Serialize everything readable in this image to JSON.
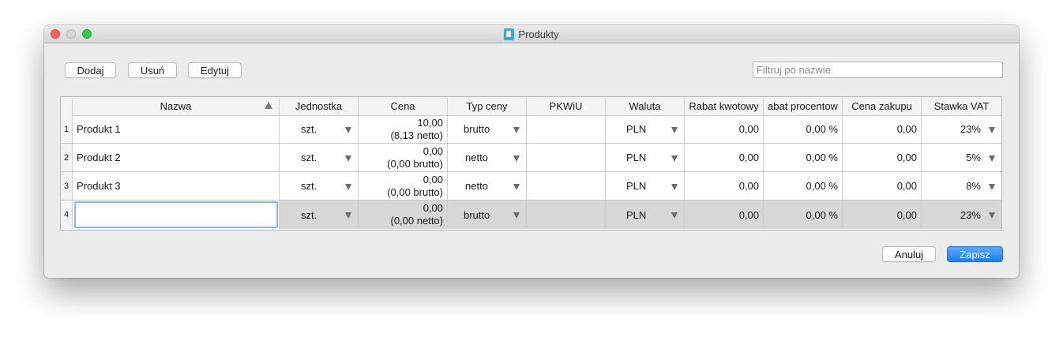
{
  "window": {
    "title": "Produkty"
  },
  "toolbar": {
    "add_label": "Dodaj",
    "remove_label": "Usuń",
    "edit_label": "Edytuj"
  },
  "filter": {
    "placeholder": "Filtruj po nazwie",
    "value": ""
  },
  "table": {
    "columns": [
      "Nazwa",
      "Jednostka",
      "Cena",
      "Typ ceny",
      "PKWiU",
      "Waluta",
      "Rabat kwotowy",
      "abat procentow",
      "Cena zakupu",
      "Stawka VAT"
    ],
    "rows": [
      {
        "index": "1",
        "name": "Produkt 1",
        "unit": "szt.",
        "price": "10,00",
        "price_alt": "(8,13 netto)",
        "price_type": "brutto",
        "pkwiu": "",
        "currency": "PLN",
        "discount_amount": "0,00",
        "discount_percent": "0,00 %",
        "purchase_price": "0,00",
        "vat": "23%"
      },
      {
        "index": "2",
        "name": "Produkt 2",
        "unit": "szt.",
        "price": "0,00",
        "price_alt": "(0,00 brutto)",
        "price_type": "netto",
        "pkwiu": "",
        "currency": "PLN",
        "discount_amount": "0,00",
        "discount_percent": "0,00 %",
        "purchase_price": "0,00",
        "vat": "5%"
      },
      {
        "index": "3",
        "name": "Produkt 3",
        "unit": "szt.",
        "price": "0,00",
        "price_alt": "(0,00 brutto)",
        "price_type": "netto",
        "pkwiu": "",
        "currency": "PLN",
        "discount_amount": "0,00",
        "discount_percent": "0,00 %",
        "purchase_price": "0,00",
        "vat": "8%"
      },
      {
        "index": "4",
        "name": "",
        "unit": "szt.",
        "price": "0,00",
        "price_alt": "(0,00 netto)",
        "price_type": "brutto",
        "pkwiu": "",
        "currency": "PLN",
        "discount_amount": "0,00",
        "discount_percent": "0,00 %",
        "purchase_price": "0,00",
        "vat": "23%"
      }
    ]
  },
  "footer": {
    "cancel_label": "Anuluj",
    "save_label": "Zapisz"
  },
  "icons": {
    "title_icon": "document-icon",
    "sort": "sort-ascending-icon",
    "dropdown": "dropdown-arrow-icon"
  },
  "colors": {
    "accent": "#1c7ef5",
    "selection_border": "#8eb8ec",
    "new_row": "#d7d7d7"
  }
}
